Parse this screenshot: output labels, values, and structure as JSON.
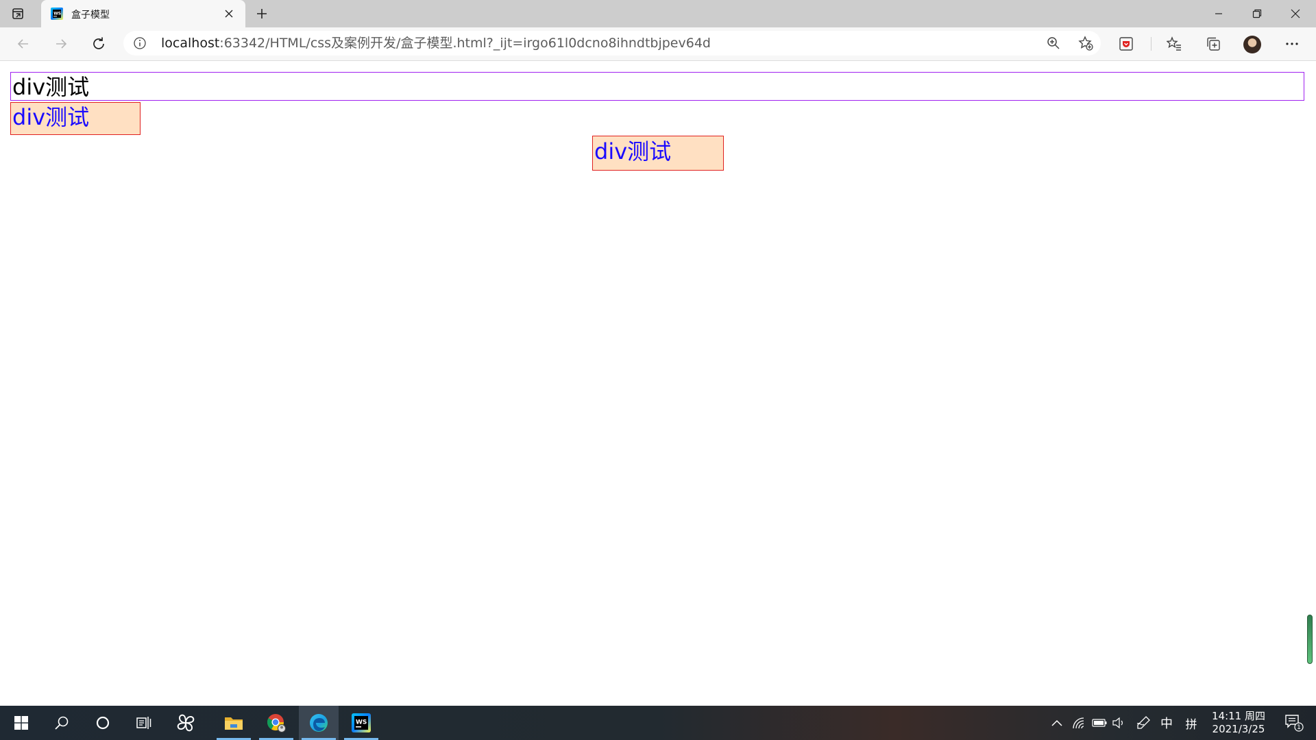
{
  "browser": {
    "tab": {
      "title": "盒子模型"
    },
    "address": {
      "host": "localhost",
      "rest": ":63342/HTML/css及案例开发/盒子模型.html?_ijt=irgo61l0dcno8ihndtbjpev64d"
    }
  },
  "page": {
    "box1": {
      "text": "div测试"
    },
    "box2": {
      "text": "div测试"
    },
    "box3": {
      "text": "div测试"
    }
  },
  "taskbar": {
    "tray": {
      "ime_lang": "中",
      "ime_mode": "拼"
    },
    "clock": {
      "time": "14:11 周四",
      "date": "2021/3/25"
    },
    "notifications": {
      "count": "1"
    }
  },
  "colors": {
    "box1_border": "#a020f0",
    "box_border": "#e0201e",
    "box_bg": "#ffe0c2",
    "box_text": "#1a0aff",
    "taskbar_accent": "#76b9ed"
  },
  "icons": [
    "tab-actions-icon",
    "webstorm-favicon-icon",
    "close-icon",
    "plus-icon",
    "minimize-icon",
    "restore-icon",
    "back-arrow-icon",
    "forward-arrow-icon",
    "refresh-icon",
    "info-icon",
    "zoom-icon",
    "add-favorite-icon",
    "extension-icon",
    "favorites-icon",
    "collections-icon",
    "more-icon",
    "windows-start-icon",
    "search-icon",
    "cortana-icon",
    "task-view-icon",
    "file-explorer-icon",
    "chrome-icon",
    "edge-icon",
    "webstorm-icon",
    "chevron-up-icon",
    "wifi-icon",
    "battery-icon",
    "volume-icon",
    "pen-icon",
    "notification-icon"
  ]
}
